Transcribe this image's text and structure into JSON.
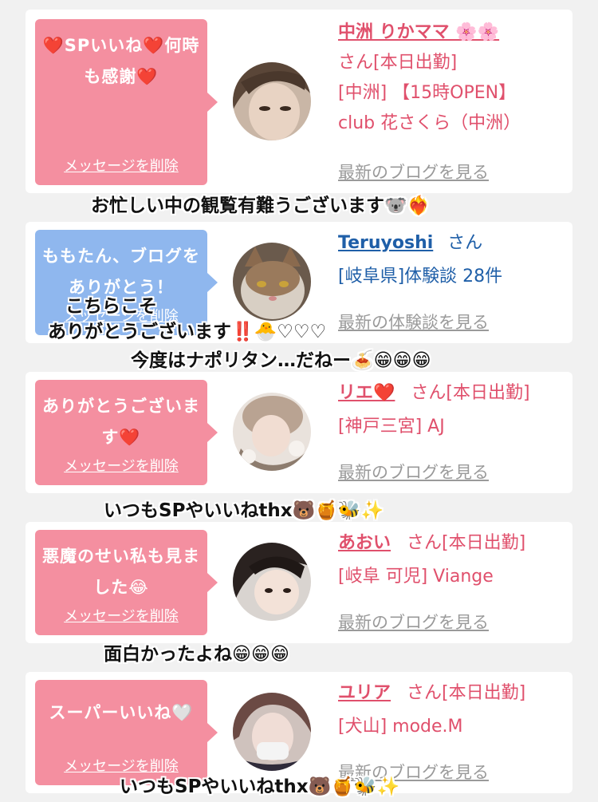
{
  "cards": [
    {
      "bubble": "❤️SPいいね❤️何時も感謝❤️",
      "delete": "メッセージを削除",
      "name": "中洲 りかママ 🌸🌸",
      "san": "さん[本日出勤]",
      "line2": "[中洲] 【15時OPEN】",
      "line3": "club 花さくら（中洲）",
      "link": "最新のブログを見る"
    },
    {
      "bubble": "ももたん、ブログをありがとう！",
      "delete": "メッセージを削除",
      "name": "Teruyoshi",
      "san": "さん",
      "line2": "[岐阜県]体験談 28件",
      "link": "最新の体験談を見る"
    },
    {
      "bubble": "ありがとうございます❤️",
      "delete": "メッセージを削除",
      "name": "リエ❤️",
      "san": "さん[本日出勤]",
      "line2": "[神戸三宮] AJ",
      "link": "最新のブログを見る"
    },
    {
      "bubble": "悪魔のせい私も見ました😂",
      "delete": "メッセージを削除",
      "name": "あおい",
      "san": "さん[本日出勤]",
      "line2": "[岐阜 可児] Viange",
      "link": "最新のブログを見る"
    },
    {
      "bubble": "スーパーいいね🤍",
      "delete": "メッセージを削除",
      "name": "ユリア",
      "san": "さん[本日出勤]",
      "line2": "[犬山] mode.M",
      "link": "最新のブログを見る"
    }
  ],
  "overlays": {
    "o1": "お忙しい中の観覧有難うございます🐨❤️‍🔥",
    "o2a": "こちらこそ",
    "o2b": "ありがとうございます‼️🐣♡♡♡",
    "o3": "今度はナポリタン…だねー🍝😁😁😁",
    "o4": "いつもSPやいいねthx🐻🍯🐝✨",
    "o5": "面白かったよね😁😁😁",
    "o6": "いつもSPやいいねthx🐻🍯🐝✨"
  }
}
